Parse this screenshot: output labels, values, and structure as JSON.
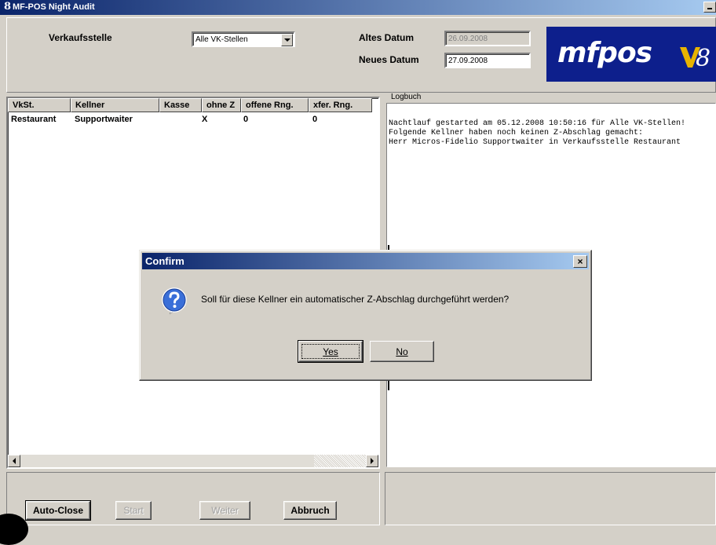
{
  "window": {
    "title": "MF-POS Night Audit"
  },
  "header": {
    "verkaufsstelle_label": "Verkaufsstelle",
    "verkaufsstelle_value": "Alle VK-Stellen",
    "altes_datum_label": "Altes Datum",
    "altes_datum_value": "26.09.2008",
    "neues_datum_label": "Neues Datum",
    "neues_datum_value": "27.09.2008",
    "logo_text": "mfpos",
    "logo_version": "8"
  },
  "table": {
    "columns": [
      "VkSt.",
      "Kellner",
      "Kasse",
      "ohne Z",
      "offene Rng.",
      "xfer. Rng."
    ],
    "rows": [
      {
        "vkst": "Restaurant",
        "kellner": "Supportwaiter",
        "kasse": "",
        "ohne_z": "X",
        "offene": "0",
        "xfer": "0"
      }
    ]
  },
  "logbuch": {
    "title": "Logbuch",
    "lines": [
      "Nachtlauf gestarted am 05.12.2008 10:50:16 für Alle VK-Stellen!",
      "Folgende Kellner haben noch keinen Z-Abschlag gemacht:",
      "Herr Micros-Fidelio Supportwaiter in Verkaufsstelle Restaurant"
    ]
  },
  "buttons": {
    "autoclose": "Auto-Close",
    "start": "Start",
    "weiter": "Weiter",
    "abbruch": "Abbruch"
  },
  "dialog": {
    "title": "Confirm",
    "message": "Soll für diese Kellner ein automatischer Z-Abschlag durchgeführt werden?",
    "yes_label": "Yes",
    "no_label": "No",
    "close_glyph": "×",
    "icon": "question-icon"
  },
  "colors": {
    "titlebar_start": "#0a246a",
    "titlebar_end": "#a6caf0",
    "window_bg": "#d4d0c8",
    "logo_bg": "#0d1f8c"
  }
}
